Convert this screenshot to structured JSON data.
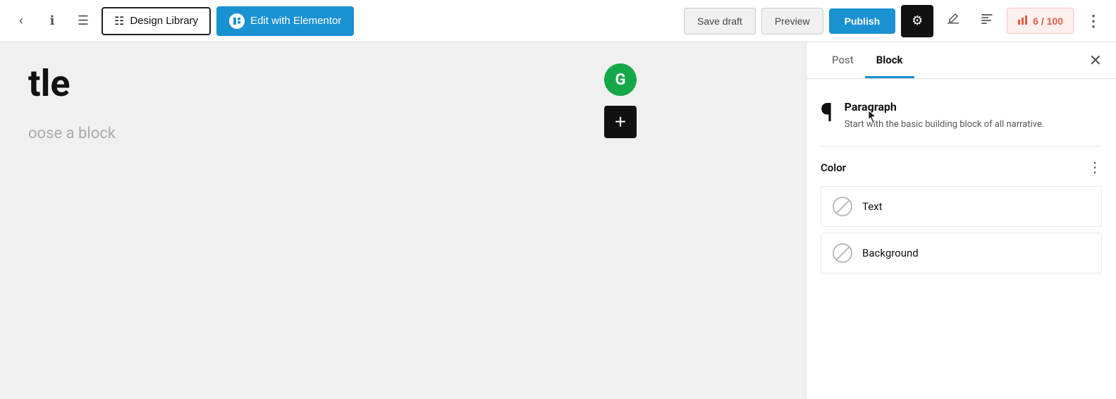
{
  "toolbar": {
    "info_icon": "ℹ",
    "menu_icon": "≡",
    "design_library_label": "Design Library",
    "edit_elementor_label": "Edit with Elementor",
    "save_draft_label": "Save draft",
    "preview_label": "Preview",
    "publish_label": "Publish",
    "settings_icon": "⚙",
    "pencil_icon": "✎",
    "list_icon": "≡",
    "score_label": "6 / 100",
    "more_icon": "⋮"
  },
  "editor": {
    "post_title": "tle",
    "add_block_placeholder": "oose a block"
  },
  "sidebar": {
    "post_tab": "Post",
    "block_tab": "Block",
    "close_icon": "✕",
    "block_title": "Paragraph",
    "block_description": "Start with the basic building block of all narrative.",
    "color_section_title": "Color",
    "color_more_icon": "⋮",
    "text_color_label": "Text",
    "background_color_label": "Background"
  }
}
